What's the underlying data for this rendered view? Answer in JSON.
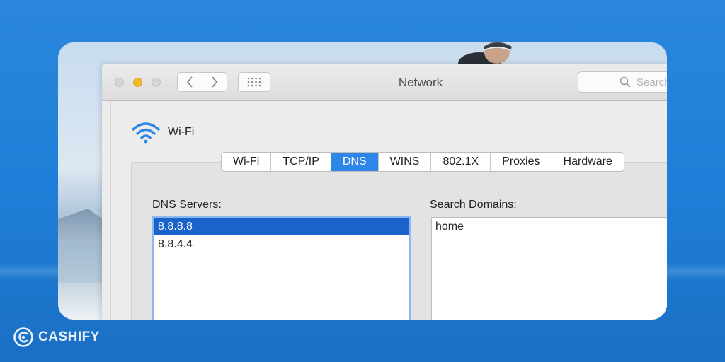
{
  "window": {
    "title": "Network"
  },
  "search": {
    "placeholder": "Search"
  },
  "service": {
    "name": "Wi-Fi",
    "icon": "wifi-icon"
  },
  "tabs": [
    "Wi-Fi",
    "TCP/IP",
    "DNS",
    "WINS",
    "802.1X",
    "Proxies",
    "Hardware"
  ],
  "active_tab": "DNS",
  "dns": {
    "label": "DNS Servers:",
    "servers": [
      "8.8.8.8",
      "8.8.4.4"
    ],
    "selected": "8.8.8.8"
  },
  "domains": {
    "label": "Search Domains:",
    "items": [
      "home"
    ]
  },
  "brand": {
    "name": "CASHIFY"
  },
  "colors": {
    "accent": "#2f86e9",
    "selection": "#1b63cc",
    "background": "#1f7fd8"
  }
}
